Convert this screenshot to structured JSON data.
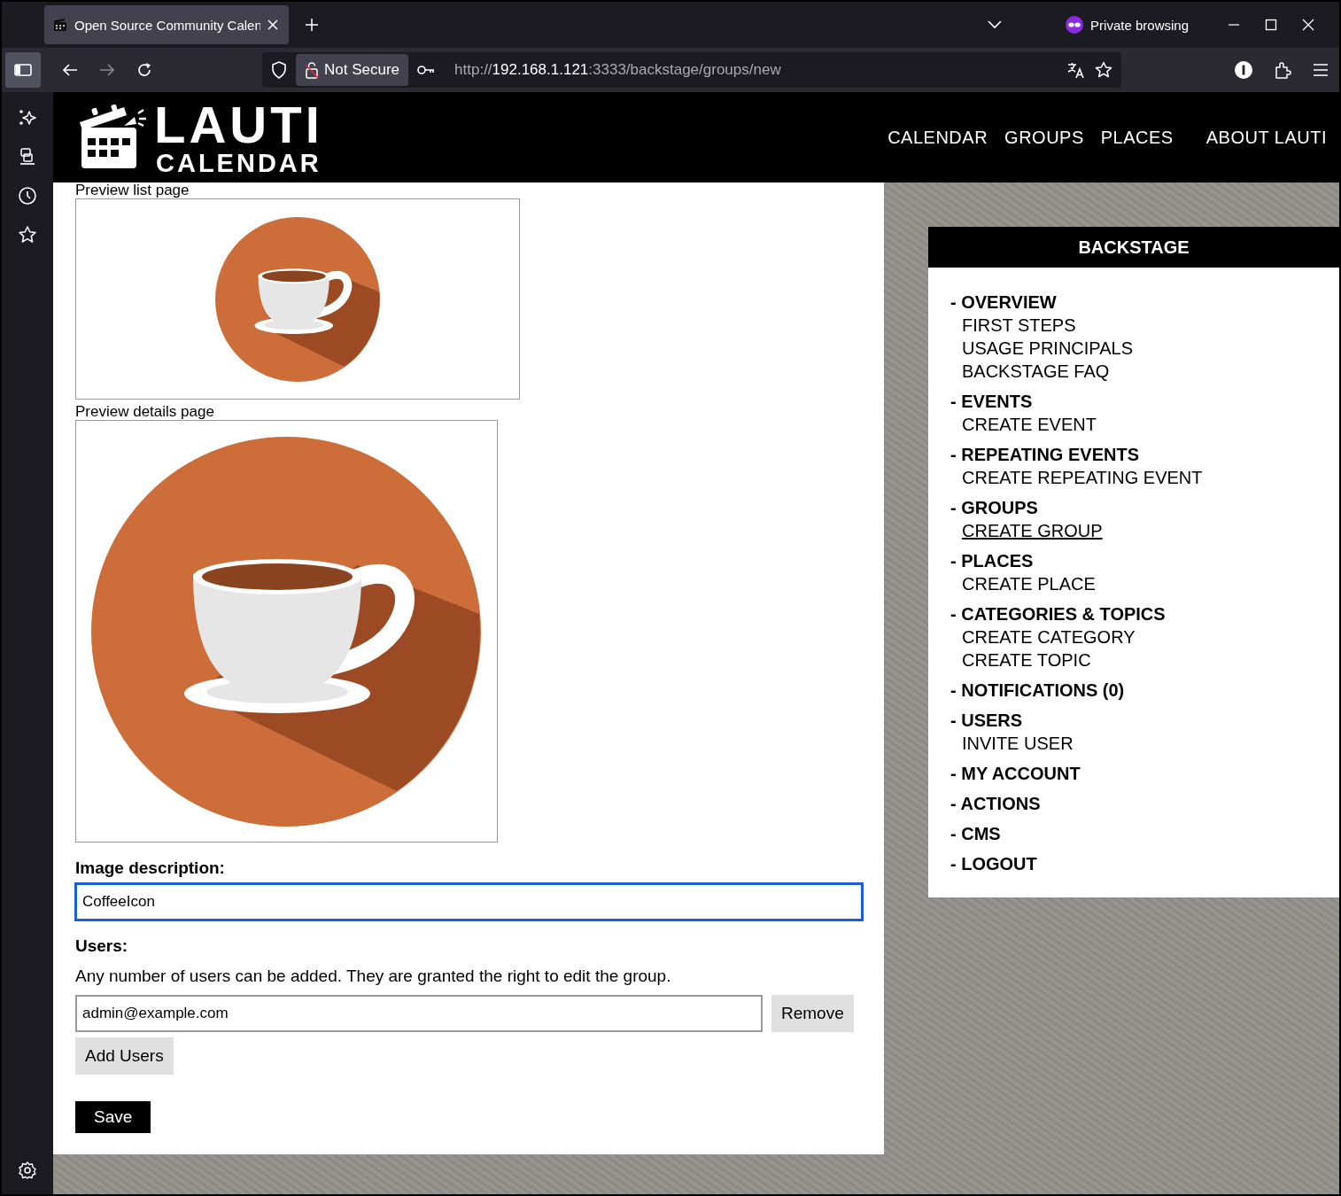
{
  "browser": {
    "tab_title": "Open Source Community Calen",
    "private_label": "Private browsing",
    "security_label": "Not Secure",
    "url_scheme": "http://",
    "url_host": "192.168.1.121",
    "url_rest": ":3333/backstage/groups/new"
  },
  "header": {
    "logo_top": "LAUTI",
    "logo_bottom": "CALENDAR",
    "nav": [
      "CALENDAR",
      "GROUPS",
      "PLACES",
      "ABOUT LAUTI"
    ]
  },
  "form": {
    "preview_list_label": "Preview list page",
    "preview_details_label": "Preview details page",
    "image_description_label": "Image description:",
    "image_description": {
      "value": "CoffeeIcon",
      "focused": true
    },
    "users_label": "Users:",
    "users_help": "Any number of users can be added. They are granted the right to edit the group.",
    "users": [
      {
        "email": "admin@example.com",
        "remove_label": "Remove"
      }
    ],
    "add_users_label": "Add Users",
    "save_label": "Save"
  },
  "backstage": {
    "title": "BACKSTAGE",
    "sections": [
      {
        "title": "- OVERVIEW",
        "links": [
          {
            "label": "FIRST STEPS",
            "selected": false
          },
          {
            "label": "USAGE PRINCIPALS",
            "selected": false
          },
          {
            "label": "BACKSTAGE FAQ",
            "selected": false
          }
        ]
      },
      {
        "title": "- EVENTS",
        "links": [
          {
            "label": "CREATE EVENT",
            "selected": false
          }
        ]
      },
      {
        "title": "- REPEATING EVENTS",
        "links": [
          {
            "label": "CREATE REPEATING EVENT",
            "selected": false
          }
        ]
      },
      {
        "title": "- GROUPS",
        "links": [
          {
            "label": "CREATE GROUP",
            "selected": true
          }
        ]
      },
      {
        "title": "- PLACES",
        "links": [
          {
            "label": "CREATE PLACE",
            "selected": false
          }
        ]
      },
      {
        "title": "- CATEGORIES & TOPICS",
        "links": [
          {
            "label": "CREATE CATEGORY",
            "selected": false
          },
          {
            "label": "CREATE TOPIC",
            "selected": false
          }
        ]
      },
      {
        "title": "- NOTIFICATIONS (0)"
      },
      {
        "title": "- USERS",
        "links": [
          {
            "label": "INVITE USER",
            "selected": false
          }
        ]
      },
      {
        "title": "- MY ACCOUNT"
      },
      {
        "title": "- ACTIONS"
      },
      {
        "title": "- CMS"
      },
      {
        "title": "- LOGOUT"
      }
    ]
  }
}
